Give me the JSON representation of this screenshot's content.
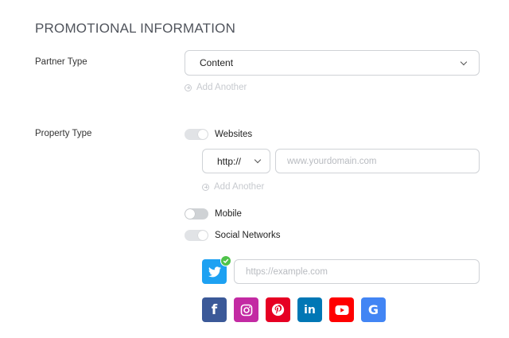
{
  "section": {
    "title": "PROMOTIONAL INFORMATION"
  },
  "partner_type": {
    "label": "Partner Type",
    "selected": "Content",
    "add_another": "Add Another"
  },
  "property_type": {
    "label": "Property Type",
    "websites": {
      "label": "Websites",
      "toggle_on": true,
      "protocol_selected": "http://",
      "domain_placeholder": "www.yourdomain.com",
      "add_another": "Add Another"
    },
    "mobile": {
      "label": "Mobile",
      "toggle_on": false
    },
    "social_networks": {
      "label": "Social Networks",
      "toggle_on": true,
      "url_placeholder": "https://example.com",
      "active_network": "twitter",
      "networks": [
        {
          "name": "twitter",
          "glyph": "twitter-icon",
          "color": "#1da1f2"
        },
        {
          "name": "facebook",
          "glyph": "f",
          "color": "#3b5998"
        },
        {
          "name": "instagram",
          "glyph": "instagram-icon",
          "color": "#c32aa3"
        },
        {
          "name": "pinterest",
          "glyph": "pinterest-icon",
          "color": "#e60023"
        },
        {
          "name": "linkedin",
          "glyph": "in",
          "color": "#0077b5"
        },
        {
          "name": "youtube",
          "glyph": "youtube-icon",
          "color": "#ff0000"
        },
        {
          "name": "google",
          "glyph": "G",
          "color": "#4285f4"
        }
      ]
    }
  },
  "colors": {
    "accent_check": "#4fc34a",
    "placeholder": "#b8bbc0",
    "disabled_text": "#c7cacf",
    "border": "#cfd2d6"
  }
}
